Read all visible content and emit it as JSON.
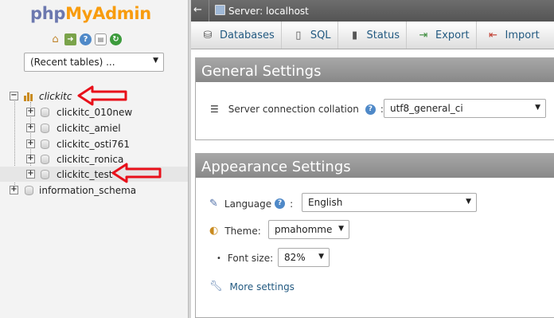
{
  "logo": {
    "php": "php",
    "myadmin": "MyAdmin"
  },
  "nav_icons": [
    "home-icon",
    "exit-icon",
    "help-icon",
    "docs-icon",
    "reload-icon"
  ],
  "recent_tables": {
    "value": "(Recent tables) ..."
  },
  "tree": {
    "databases": [
      {
        "name": "clickitc",
        "expanded": true,
        "italic": true,
        "children": [
          "clickitc_010new",
          "clickitc_amiel",
          "clickitc_osti761",
          "clickitc_ronica",
          "clickitc_test"
        ]
      },
      {
        "name": "information_schema",
        "expanded": false,
        "italic": false,
        "children": []
      }
    ],
    "highlighted": "clickitc_test"
  },
  "annotation_color": "#e8101a",
  "server_bar": {
    "label": "Server: localhost"
  },
  "tabs": [
    {
      "label": "Databases",
      "icon": "database-icon"
    },
    {
      "label": "SQL",
      "icon": "sql-icon"
    },
    {
      "label": "Status",
      "icon": "status-icon"
    },
    {
      "label": "Export",
      "icon": "export-icon"
    },
    {
      "label": "Import",
      "icon": "import-icon"
    }
  ],
  "general_settings": {
    "title": "General Settings",
    "collation_label": "Server connection collation",
    "collation_value": "utf8_general_ci",
    "separator": ":"
  },
  "appearance_settings": {
    "title": "Appearance Settings",
    "language_label": "Language",
    "language_value": "English",
    "theme_label": "Theme:",
    "theme_value": "pmahomme",
    "font_size_label": "Font size:",
    "font_size_value": "82%",
    "more_settings": "More settings",
    "separator": ":"
  }
}
